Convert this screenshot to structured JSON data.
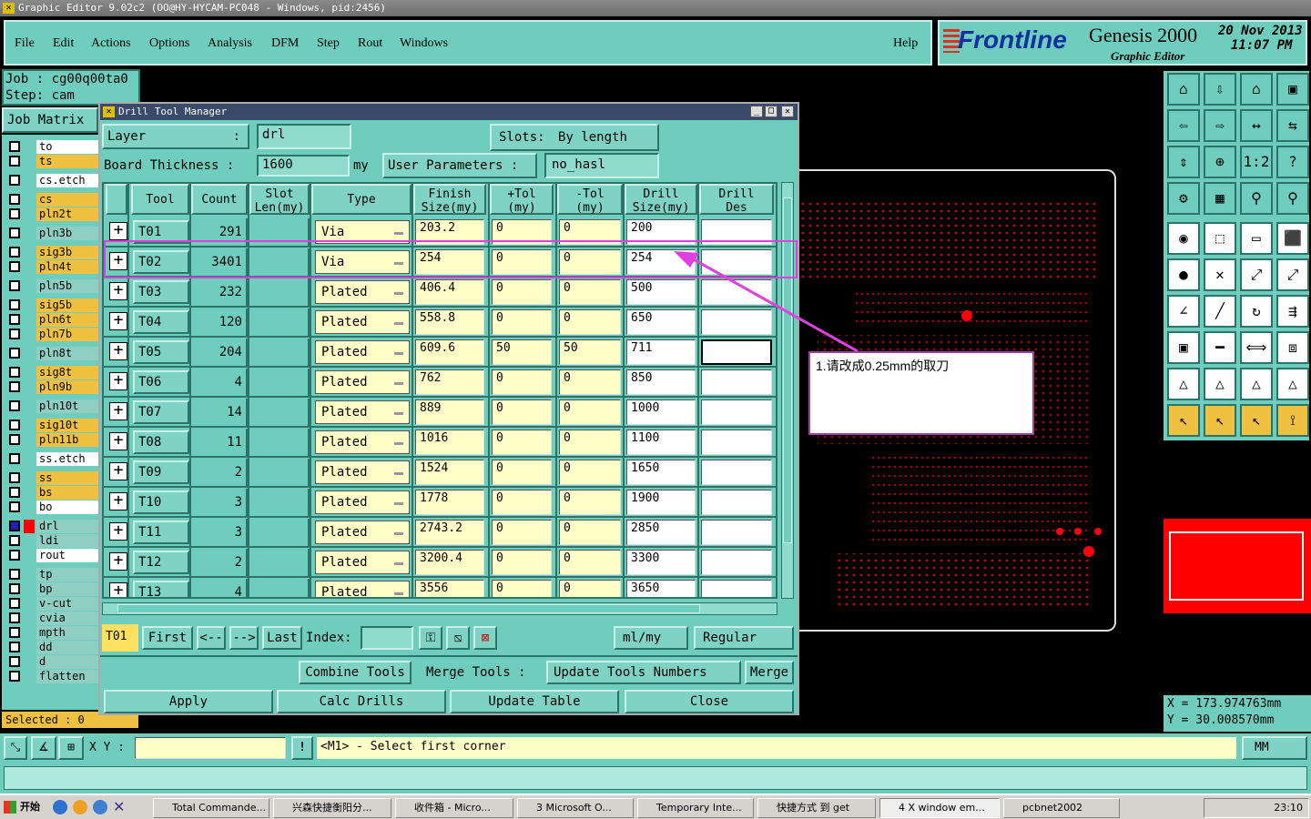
{
  "window": {
    "title": "Graphic Editor 9.02c2 (OO@HY-HYCAM-PC048 - Windows, pid:2456)"
  },
  "menu": [
    "File",
    "Edit",
    "Actions",
    "Options",
    "Analysis",
    "DFM",
    "Step",
    "Rout",
    "Windows"
  ],
  "help": "Help",
  "brand": {
    "logo": "Frontline",
    "product": "Genesis 2000",
    "sub": "Graphic Editor",
    "date": "20 Nov 2013",
    "time": "11:07 PM"
  },
  "job": {
    "job_label": "Job : cg00q00ta0",
    "step_label": "Step: cam",
    "job_matrix": "Job Matrix"
  },
  "layers": [
    {
      "name": "to",
      "style": "w"
    },
    {
      "name": "ts",
      "style": "y"
    },
    {
      "name": "cs.etch",
      "style": "w"
    },
    {
      "name": "cs",
      "style": "y"
    },
    {
      "name": "pln2t",
      "style": "y"
    },
    {
      "name": "pln3b",
      "style": "g"
    },
    {
      "name": "sig3b",
      "style": "y"
    },
    {
      "name": "pln4t",
      "style": "y"
    },
    {
      "name": "pln5b",
      "style": "g"
    },
    {
      "name": "sig5b",
      "style": "y"
    },
    {
      "name": "pln6t",
      "style": "y"
    },
    {
      "name": "pln7b",
      "style": "y"
    },
    {
      "name": "pln8t",
      "style": "g"
    },
    {
      "name": "sig8t",
      "style": "y"
    },
    {
      "name": "pln9b",
      "style": "y"
    },
    {
      "name": "pln10t",
      "style": "g"
    },
    {
      "name": "sig10t",
      "style": "y"
    },
    {
      "name": "pln11b",
      "style": "y"
    },
    {
      "name": "ss.etch",
      "style": "w"
    },
    {
      "name": "ss",
      "style": "y"
    },
    {
      "name": "bs",
      "style": "y"
    },
    {
      "name": "bo",
      "style": "w"
    },
    {
      "name": "drl",
      "style": "g"
    },
    {
      "name": "ldi",
      "style": "g"
    },
    {
      "name": "rout",
      "style": "w"
    },
    {
      "name": "tp",
      "style": "g"
    },
    {
      "name": "bp",
      "style": "g"
    },
    {
      "name": "v-cut",
      "style": "g"
    },
    {
      "name": "cvia",
      "style": "g"
    },
    {
      "name": "mpth",
      "style": "g"
    },
    {
      "name": "dd",
      "style": "g"
    },
    {
      "name": "d",
      "style": "g"
    },
    {
      "name": "flatten",
      "style": "g"
    }
  ],
  "selected": "Selected : 0",
  "dialog": {
    "title": "Drill Tool Manager",
    "layer_label": "Layer",
    "layer_value": "drl",
    "slots_label": "Slots:",
    "slots_value": "By length",
    "board_thickness_label": "Board Thickness :",
    "board_thickness_value": "1600",
    "board_thickness_unit": "my",
    "user_params_label": "User Parameters :",
    "user_params_value": "no_hasl",
    "headers": [
      "Tool",
      "Count",
      "Slot\nLen(my)",
      "Type",
      "Finish\nSize(my)",
      "+Tol\n(my)",
      "-Tol\n(my)",
      "Drill\nSize(my)",
      "Drill\nDes"
    ],
    "rows": [
      {
        "tool": "T01",
        "count": "291",
        "type": "Via",
        "finish": "203.2",
        "ptol": "0",
        "ntol": "0",
        "drill": "200",
        "des": ""
      },
      {
        "tool": "T02",
        "count": "3401",
        "type": "Via",
        "finish": "254",
        "ptol": "0",
        "ntol": "0",
        "drill": "254",
        "des": ""
      },
      {
        "tool": "T03",
        "count": "232",
        "type": "Plated",
        "finish": "406.4",
        "ptol": "0",
        "ntol": "0",
        "drill": "500",
        "des": ""
      },
      {
        "tool": "T04",
        "count": "120",
        "type": "Plated",
        "finish": "558.8",
        "ptol": "0",
        "ntol": "0",
        "drill": "650",
        "des": ""
      },
      {
        "tool": "T05",
        "count": "204",
        "type": "Plated",
        "finish": "609.6",
        "ptol": "50",
        "ntol": "50",
        "drill": "711",
        "des": ""
      },
      {
        "tool": "T06",
        "count": "4",
        "type": "Plated",
        "finish": "762",
        "ptol": "0",
        "ntol": "0",
        "drill": "850",
        "des": ""
      },
      {
        "tool": "T07",
        "count": "14",
        "type": "Plated",
        "finish": "889",
        "ptol": "0",
        "ntol": "0",
        "drill": "1000",
        "des": ""
      },
      {
        "tool": "T08",
        "count": "11",
        "type": "Plated",
        "finish": "1016",
        "ptol": "0",
        "ntol": "0",
        "drill": "1100",
        "des": ""
      },
      {
        "tool": "T09",
        "count": "2",
        "type": "Plated",
        "finish": "1524",
        "ptol": "0",
        "ntol": "0",
        "drill": "1650",
        "des": ""
      },
      {
        "tool": "T10",
        "count": "3",
        "type": "Plated",
        "finish": "1778",
        "ptol": "0",
        "ntol": "0",
        "drill": "1900",
        "des": ""
      },
      {
        "tool": "T11",
        "count": "3",
        "type": "Plated",
        "finish": "2743.2",
        "ptol": "0",
        "ntol": "0",
        "drill": "2850",
        "des": ""
      },
      {
        "tool": "T12",
        "count": "2",
        "type": "Plated",
        "finish": "3200.4",
        "ptol": "0",
        "ntol": "0",
        "drill": "3300",
        "des": ""
      },
      {
        "tool": "T13",
        "count": "4",
        "type": "Plated",
        "finish": "3556",
        "ptol": "0",
        "ntol": "0",
        "drill": "3650",
        "des": ""
      }
    ],
    "nav": {
      "current": "T01",
      "first": "First",
      "prev": "<--",
      "next": "-->",
      "last": "Last",
      "index_label": "Index:",
      "units": "ml/my",
      "mode": "Regular"
    },
    "actions": {
      "combine": "Combine Tools",
      "merge_label": "Merge Tools :",
      "update_numbers": "Update Tools Numbers",
      "merge": "Merge"
    },
    "footer": {
      "apply": "Apply",
      "calc": "Calc Drills",
      "update_table": "Update Table",
      "close": "Close"
    }
  },
  "callout": "1.请改成0.25mm的取刀",
  "status": {
    "xy_label": "X Y :",
    "message": "<M1> - Select first corner",
    "units": "MM"
  },
  "coords": {
    "x": "X  =  173.974763mm",
    "y": "Y  =  30.008570mm"
  },
  "taskbar": {
    "start": "开始",
    "tasks": [
      "Total Comman​de...",
      "兴森快捷衡阳分...",
      "收件箱 - Micro...",
      "3 Microsoft O...",
      "Temporary Inte...",
      "快捷方式 到 get",
      "4 X window em...",
      "pcbnet2002"
    ],
    "clock": "23:10"
  },
  "colors": {
    "teal": "#6ecdbd",
    "red": "#ff0000",
    "highlight": "#e040e0"
  }
}
